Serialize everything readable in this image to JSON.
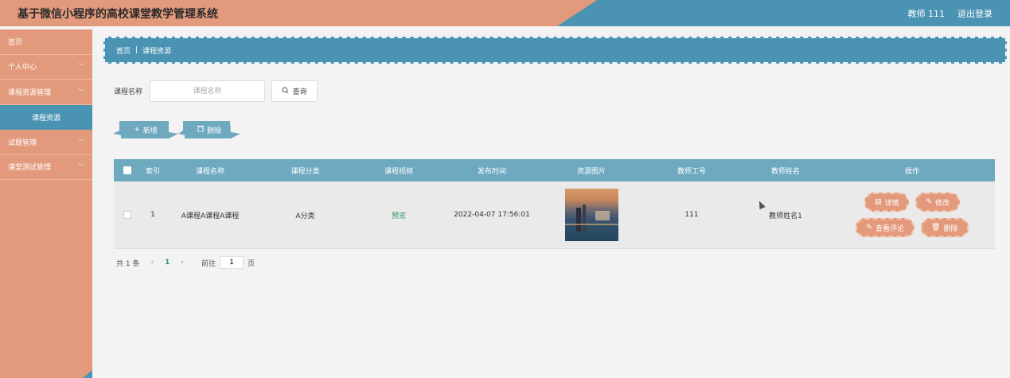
{
  "header": {
    "title": "基于微信小程序的高校课堂教学管理系统",
    "user": "教师 111",
    "logout": "退出登录"
  },
  "sidebar": {
    "items": [
      {
        "label": "首页"
      },
      {
        "label": "个人中心"
      },
      {
        "label": "课程资源管理"
      },
      {
        "label": "课程资源",
        "sub": true
      },
      {
        "label": "试题管理"
      },
      {
        "label": "课堂测试管理"
      }
    ]
  },
  "breadcrumb": {
    "home": "首页",
    "sep": "|",
    "current": "课程资源"
  },
  "search": {
    "label": "课程名称",
    "placeholder": "课程名称",
    "button": "查询"
  },
  "actions": {
    "add": "新增",
    "delete": "删除"
  },
  "table": {
    "headers": [
      "",
      "索引",
      "课程名称",
      "课程分类",
      "课程视频",
      "发布时间",
      "资源图片",
      "教师工号",
      "教师姓名",
      "操作"
    ],
    "rows": [
      {
        "index": "1",
        "name": "A课程A课程A课程",
        "category": "A分类",
        "video": "预览",
        "time": "2022-04-07 17:56:01",
        "teacher_id": "111",
        "teacher_name": "教师姓名1"
      }
    ],
    "ops": {
      "detail": "详情",
      "edit": "修改",
      "comments": "查看评论",
      "delete": "删除"
    }
  },
  "pager": {
    "total": "共 1 条",
    "prev": "‹",
    "page": "1",
    "next": "›",
    "goto": "前往",
    "input": "1",
    "unit": "页"
  },
  "colors": {
    "header_blue": "#4a93b3",
    "header_salmon": "#e39a7c",
    "table_head": "#6ea9c0",
    "preview_green": "#2c9a5c"
  }
}
